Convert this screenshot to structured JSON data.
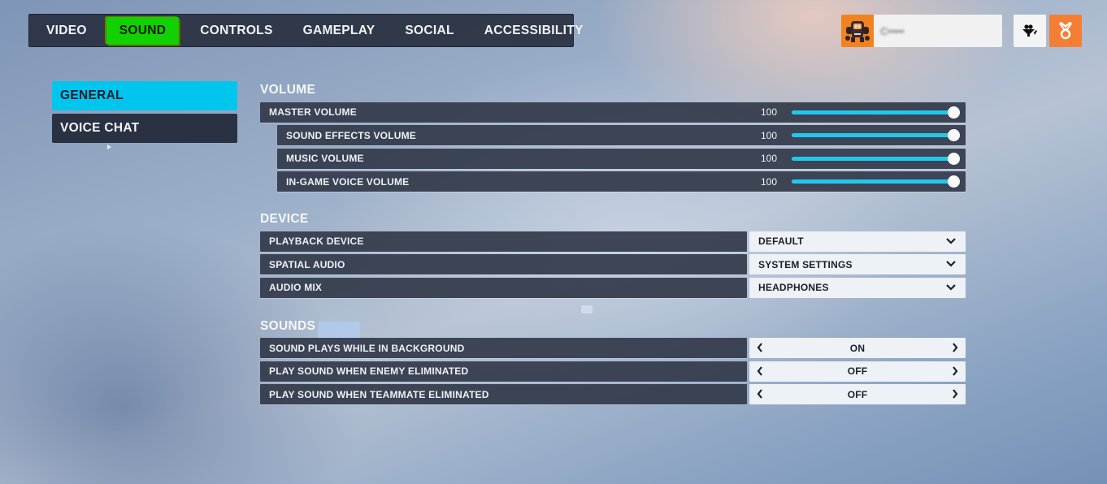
{
  "nav": {
    "tabs": [
      {
        "label": "VIDEO",
        "active": false
      },
      {
        "label": "SOUND",
        "active": true
      },
      {
        "label": "CONTROLS",
        "active": false
      },
      {
        "label": "GAMEPLAY",
        "active": false
      },
      {
        "label": "SOCIAL",
        "active": false
      },
      {
        "label": "ACCESSIBILITY",
        "active": false
      }
    ]
  },
  "profile": {
    "avatar_icon": "robot-avatar-icon",
    "username": "C•••••",
    "social_icon": "group-icon",
    "reward_icon": "medal-icon"
  },
  "sidemenu": {
    "items": [
      {
        "label": "GENERAL",
        "active": true
      },
      {
        "label": "VOICE CHAT",
        "active": false
      }
    ]
  },
  "volume": {
    "title": "VOLUME",
    "rows": [
      {
        "label": "MASTER VOLUME",
        "value": "100",
        "percent": 100
      },
      {
        "label": "SOUND EFFECTS VOLUME",
        "value": "100",
        "percent": 100
      },
      {
        "label": "MUSIC VOLUME",
        "value": "100",
        "percent": 100
      },
      {
        "label": "IN-GAME VOICE VOLUME",
        "value": "100",
        "percent": 100
      }
    ]
  },
  "device": {
    "title": "DEVICE",
    "rows": [
      {
        "label": "PLAYBACK DEVICE",
        "value": "DEFAULT"
      },
      {
        "label": "SPATIAL AUDIO",
        "value": "SYSTEM SETTINGS"
      },
      {
        "label": "AUDIO MIX",
        "value": "HEADPHONES"
      }
    ]
  },
  "sounds": {
    "title": "SOUNDS",
    "rows": [
      {
        "label": "SOUND PLAYS WHILE IN BACKGROUND",
        "value": "ON"
      },
      {
        "label": "PLAY SOUND WHEN ENEMY ELIMINATED",
        "value": "OFF"
      },
      {
        "label": "PLAY SOUND WHEN TEAMMATE ELIMINATED",
        "value": "OFF"
      }
    ]
  },
  "colors": {
    "active_tab": "#11d100",
    "active_side": "#00c6ee",
    "slider_fill": "#22c8ec",
    "accent_orange": "#f57e35"
  }
}
